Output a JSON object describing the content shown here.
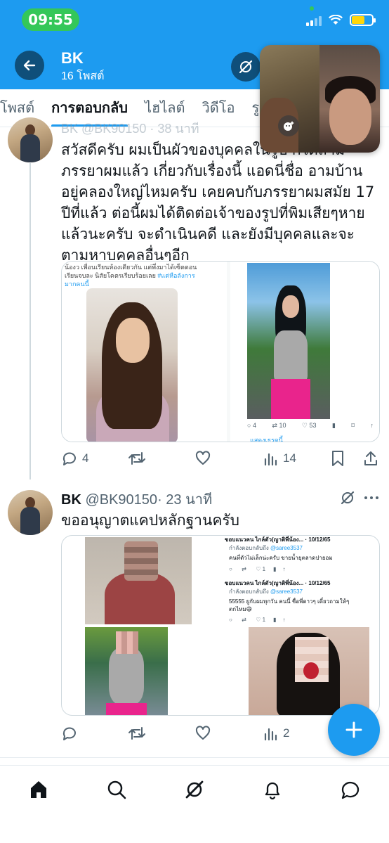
{
  "status_bar": {
    "time": "09:55"
  },
  "header": {
    "name": "BK",
    "post_count": "16 โพสต์"
  },
  "tabs": [
    {
      "label": "โพสต์"
    },
    {
      "label": "การตอบกลับ"
    },
    {
      "label": "ไฮไลต์"
    },
    {
      "label": "วิดีโอ"
    },
    {
      "label": "รู"
    }
  ],
  "tweet1": {
    "cut_header": "BK @BK90150 · 38 นาที",
    "text": "สวัสดีครับ ผมเป็นผัวของบุคคลในรูป ก็ได้ถามภรรยาผมแล้ว เกี่ยวกับเรื่องนี้ แอดนี่ชื่อ อามบ้าน อยู่คลองใหญ่ไหมครับ เคยคบกับภรรยาผมสมัย 17 ปีที่แล้ว ต่อนี้ผมได้ติดต่อเจ้าของรูปที่พิมเสียๆหายแล้วนะครับ จะดำเนินคดี และยังมีบุคคลและจะตามหาบุคคลอื่นๆอีก",
    "media": {
      "caption_line1": "น้องว เพื่อนเรียนห้องเดียวกัน แต่พึ่งมาได้เซ็ตตอน",
      "caption_line2": "เรียนจบละ นิสัยโคตรเรียบร้อยเลย",
      "caption_tag": "#แต่หือลังการ",
      "caption_line3": "มากคนนี้",
      "mini_replies": "4",
      "mini_reposts": "10",
      "mini_likes": "53",
      "mini_link": "แสดงเธรดนี้"
    },
    "replies": "4",
    "views": "14"
  },
  "tweet2": {
    "name": "BK",
    "handle": "@BK90150",
    "time": "· 23 นาที",
    "text": "ขออนุญาตแคปหลักฐานครับ",
    "media": {
      "tw1_head": "ขอบแนวคน ไกล์ตัว(ญาติพี่น้อง... · 10/12/65",
      "tw1_reply": "กำลังตอบกลับถึง",
      "tw1_mention": "@saree3537",
      "tw1_body": "คนที่ตัวไม่เล็กน่ะครับ ขายน้ำยุตลาดปายอม",
      "tw2_head": "ขอบแนวคน ไกล์ตัว(ญาติพี่น้อง... · 10/12/65",
      "tw2_reply": "กำลังตอบกลับถึง",
      "tw2_mention": "@saree3537",
      "tw2_body": "55555 ยูกับผมทุกวัน คนนี้ ชื่อพี่ดาวๆ เดี๋ยวถามให้ๆ",
      "tw2_body2": "ตกไหม😄",
      "tw1_likes": "1",
      "tw2_likes": "1"
    },
    "views": "2"
  },
  "colors": {
    "accent": "#1d9bf0",
    "status_green": "#34c759",
    "text": "#0f1419",
    "muted": "#536471"
  },
  "icons": {
    "back": "arrow-left-icon",
    "grok": "grok-icon",
    "reply": "reply-icon",
    "repost": "repost-icon",
    "like": "heart-icon",
    "views": "views-bar-icon",
    "bookmark": "bookmark-icon",
    "share": "share-icon",
    "more": "more-dots-icon",
    "compose": "plus-icon",
    "home": "home-icon",
    "search": "search-icon",
    "notifications": "bell-icon",
    "messages": "message-icon"
  }
}
